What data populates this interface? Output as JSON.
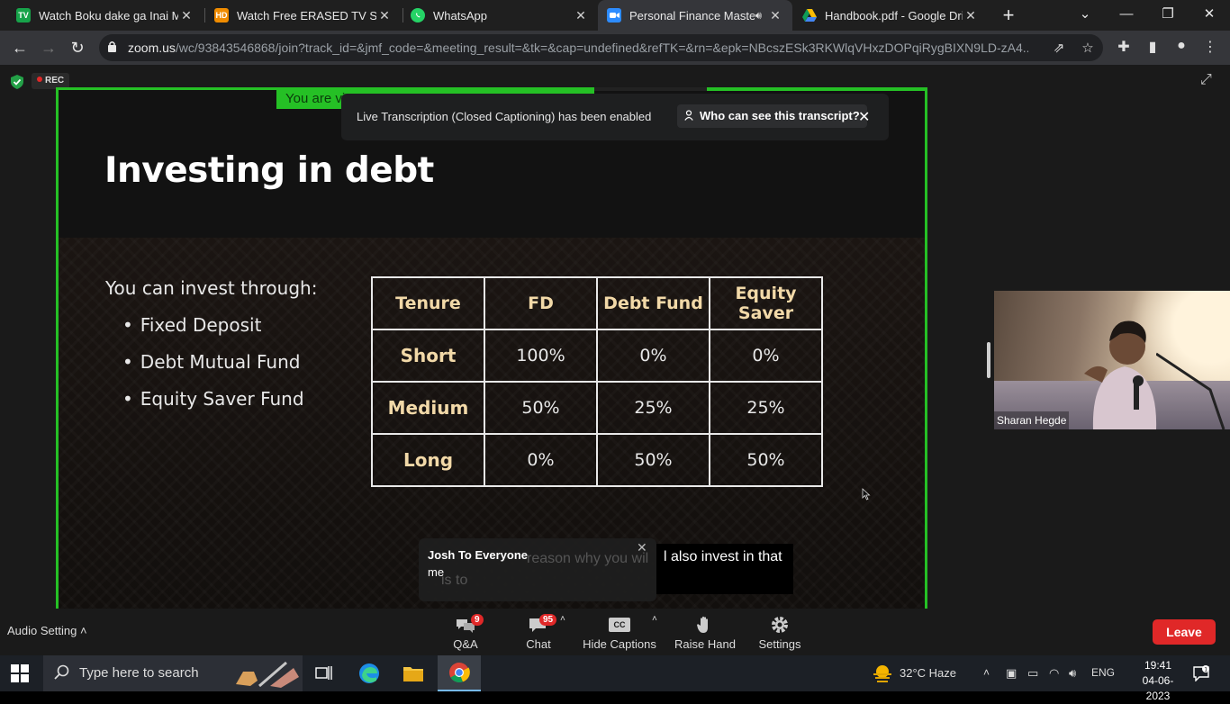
{
  "browser": {
    "tabs": [
      {
        "title": "Watch Boku dake ga Inai Mac",
        "favicon": "TV",
        "favicon_color": "#17a34a"
      },
      {
        "title": "Watch Free ERASED TV Show",
        "favicon": "HD",
        "favicon_color": "#f08c00"
      },
      {
        "title": "WhatsApp",
        "favicon": "whatsapp-icon",
        "favicon_color": "#25d366"
      },
      {
        "title": "Personal Finance Master",
        "favicon": "zoom-icon",
        "favicon_color": "#2d8cff",
        "active": true,
        "audio": true
      },
      {
        "title": "Handbook.pdf - Google Drive",
        "favicon": "drive-icon",
        "favicon_color": "#fbbc04"
      }
    ],
    "url_host": "zoom.us",
    "url_rest": "/wc/93843546868/join?track_id=&jmf_code=&meeting_result=&tk=&cap=undefined&refTK=&rn=&epk=NBcszESk3RKWlqVHxzDOPqiRygBIXN9LD-zA4..."
  },
  "zoom": {
    "rec_label": "REC",
    "view_banner": "You are vi",
    "toast": {
      "text": "Live Transcription (Closed Captioning) has been enabled",
      "button": "Who can see this transcript?"
    },
    "slide": {
      "title": "Investing in debt",
      "intro": "You can invest through:",
      "bullets": [
        "Fixed Deposit",
        "Debt Mutual Fund",
        "Equity Saver Fund"
      ],
      "table": {
        "headers": [
          "Tenure",
          "FD",
          "Debt Fund",
          "Equity Saver"
        ],
        "rows": [
          [
            "Short",
            "100%",
            "0%",
            "0%"
          ],
          [
            "Medium",
            "50%",
            "25%",
            "25%"
          ],
          [
            "Long",
            "0%",
            "50%",
            "50%"
          ]
        ]
      }
    },
    "caption": "l also invest in that",
    "chat_popup": {
      "from": "Josh To Everyone",
      "message": "me",
      "ghost_text": "reason why you wil",
      "ghost_text2": "is to"
    },
    "participant": {
      "name": "Sharan Hegde"
    },
    "toolbar": {
      "audio_setting": "Audio Setting",
      "qa": {
        "label": "Q&A",
        "badge": "9"
      },
      "chat": {
        "label": "Chat",
        "badge": "95"
      },
      "captions": {
        "label": "Hide Captions",
        "icon_text": "CC"
      },
      "raise_hand": {
        "label": "Raise Hand"
      },
      "settings": {
        "label": "Settings"
      },
      "leave": "Leave"
    }
  },
  "taskbar": {
    "search_placeholder": "Type here to search",
    "weather": "32°C  Haze",
    "language": "ENG",
    "time": "19:41",
    "date": "04-06-2023"
  },
  "colors": {
    "share_border": "#25c025",
    "leave": "#e02828",
    "table_header_text": "#f2d9a8"
  }
}
